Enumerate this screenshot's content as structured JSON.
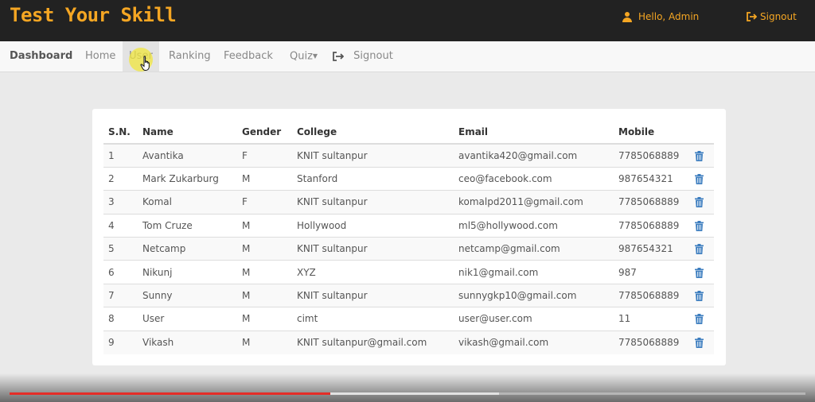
{
  "header": {
    "brand": "Test Your Skill",
    "greeting": "Hello,  Admin",
    "signout": "Signout"
  },
  "nav": {
    "brand": "Dashboard",
    "items": [
      "Home",
      "User",
      "Ranking",
      "Feedback",
      "Quiz"
    ],
    "signout": "Signout",
    "active": "User"
  },
  "table": {
    "headers": [
      "S.N.",
      "Name",
      "Gender",
      "College",
      "Email",
      "Mobile"
    ],
    "rows": [
      [
        "1",
        "Avantika",
        "F",
        "KNIT sultanpur",
        "avantika420@gmail.com",
        "7785068889"
      ],
      [
        "2",
        "Mark Zukarburg",
        "M",
        "Stanford",
        "ceo@facebook.com",
        "987654321"
      ],
      [
        "3",
        "Komal",
        "F",
        "KNIT sultanpur",
        "komalpd2011@gmail.com",
        "7785068889"
      ],
      [
        "4",
        "Tom Cruze",
        "M",
        "Hollywood",
        "ml5@hollywood.com",
        "7785068889"
      ],
      [
        "5",
        "Netcamp",
        "M",
        "KNIT sultanpur",
        "netcamp@gmail.com",
        "987654321"
      ],
      [
        "6",
        "Nikunj",
        "M",
        "XYZ",
        "nik1@gmail.com",
        "987"
      ],
      [
        "7",
        "Sunny",
        "M",
        "KNIT sultanpur",
        "sunnygkp10@gmail.com",
        "7785068889"
      ],
      [
        "8",
        "User",
        "M",
        "cimt",
        "user@user.com",
        "11"
      ],
      [
        "9",
        "Vikash",
        "M",
        "KNIT sultanpur@gmail.com",
        "vikash@gmail.com",
        "7785068889"
      ]
    ],
    "row_action_icon": "trash-icon"
  },
  "video": {
    "played_fraction": 0.403,
    "buffered_fraction": 0.615
  },
  "colors": {
    "brand": "#f5a623",
    "topbar": "#222222",
    "trash": "#3c7dbf",
    "progress": "#e52d27"
  }
}
